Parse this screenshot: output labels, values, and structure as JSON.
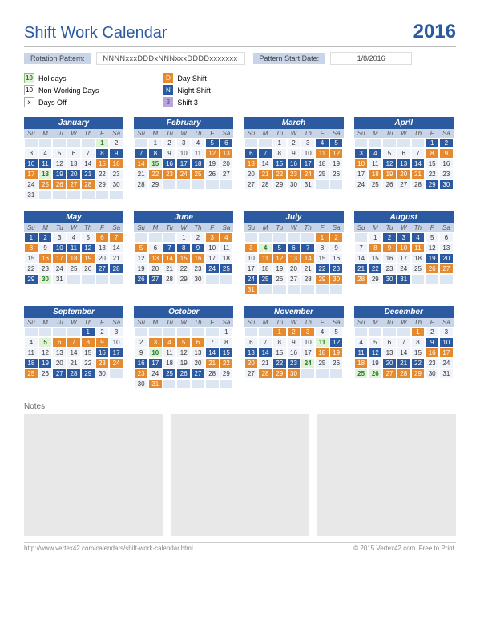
{
  "title": "Shift Work Calendar",
  "year": "2016",
  "rotation_label": "Rotation Pattern:",
  "rotation_value": "NNNNxxxDDDxNNNxxxDDDDxxxxxxx",
  "startdate_label": "Pattern Start Date:",
  "startdate_value": "1/8/2016",
  "legend": {
    "holidays": "Holidays",
    "holidays_sw": "10",
    "nonworking": "Non-Working Days",
    "nonworking_sw": "10",
    "daysoff": "Days Off",
    "daysoff_sw": "x",
    "dayshift": "Day Shift",
    "dayshift_sw": "D",
    "nightshift": "Night Shift",
    "nightshift_sw": "N",
    "shift3": "Shift 3",
    "shift3_sw": "3"
  },
  "dayheads": [
    "Su",
    "M",
    "Tu",
    "W",
    "Th",
    "F",
    "Sa"
  ],
  "notes_title": "Notes",
  "footer_left": "http://www.vertex42.com/calendars/shift-work-calendar.html",
  "footer_right": "© 2015 Vertex42.com. Free to Print.",
  "months": [
    {
      "name": "January",
      "start": 5,
      "len": 31,
      "hol": [
        1,
        18
      ],
      "pat": {
        "8": "N",
        "9": "N",
        "10": "N",
        "11": "N",
        "15": "D",
        "16": "D",
        "17": "D",
        "19": "N",
        "20": "N",
        "21": "N",
        "25": "D",
        "26": "D",
        "27": "D",
        "28": "D"
      }
    },
    {
      "name": "February",
      "start": 1,
      "len": 29,
      "hol": [
        15
      ],
      "pat": {
        "5": "N",
        "6": "N",
        "7": "N",
        "8": "N",
        "12": "D",
        "13": "D",
        "14": "D",
        "16": "N",
        "17": "N",
        "18": "N",
        "22": "D",
        "23": "D",
        "24": "D",
        "25": "D"
      }
    },
    {
      "name": "March",
      "start": 2,
      "len": 31,
      "hol": [],
      "pat": {
        "4": "N",
        "5": "N",
        "6": "N",
        "7": "N",
        "11": "D",
        "12": "D",
        "13": "D",
        "15": "N",
        "16": "N",
        "17": "N",
        "21": "D",
        "22": "D",
        "23": "D",
        "24": "D"
      }
    },
    {
      "name": "April",
      "start": 5,
      "len": 30,
      "hol": [],
      "pat": {
        "1": "N",
        "2": "N",
        "3": "N",
        "4": "N",
        "8": "D",
        "9": "D",
        "10": "D",
        "12": "N",
        "13": "N",
        "14": "N",
        "18": "D",
        "19": "D",
        "20": "D",
        "21": "D",
        "29": "N",
        "30": "N"
      }
    },
    {
      "name": "May",
      "start": 0,
      "len": 31,
      "hol": [
        30
      ],
      "pat": {
        "1": "N",
        "2": "N",
        "6": "D",
        "7": "D",
        "8": "D",
        "10": "N",
        "11": "N",
        "12": "N",
        "16": "D",
        "17": "D",
        "18": "D",
        "19": "D",
        "27": "N",
        "28": "N",
        "29": "N"
      }
    },
    {
      "name": "June",
      "start": 3,
      "len": 30,
      "hol": [],
      "pat": {
        "3": "D",
        "4": "D",
        "5": "D",
        "7": "N",
        "8": "N",
        "9": "N",
        "13": "D",
        "14": "D",
        "15": "D",
        "16": "D",
        "24": "N",
        "25": "N",
        "26": "N",
        "27": "N"
      }
    },
    {
      "name": "July",
      "start": 5,
      "len": 31,
      "hol": [
        4
      ],
      "pat": {
        "1": "D",
        "2": "D",
        "3": "D",
        "5": "N",
        "6": "N",
        "7": "N",
        "11": "D",
        "12": "D",
        "13": "D",
        "14": "D",
        "22": "N",
        "23": "N",
        "24": "N",
        "25": "N",
        "29": "D",
        "30": "D",
        "31": "D"
      }
    },
    {
      "name": "August",
      "start": 1,
      "len": 31,
      "hol": [],
      "pat": {
        "2": "N",
        "3": "N",
        "4": "N",
        "8": "D",
        "9": "D",
        "10": "D",
        "11": "D",
        "19": "N",
        "20": "N",
        "21": "N",
        "22": "N",
        "26": "D",
        "27": "D",
        "28": "D",
        "30": "N",
        "31": "N"
      }
    },
    {
      "name": "September",
      "start": 4,
      "len": 30,
      "hol": [
        5
      ],
      "pat": {
        "1": "N",
        "6": "D",
        "7": "D",
        "8": "D",
        "9": "D",
        "16": "N",
        "17": "N",
        "18": "N",
        "19": "N",
        "23": "D",
        "24": "D",
        "25": "D",
        "27": "N",
        "28": "N",
        "29": "N"
      }
    },
    {
      "name": "October",
      "start": 6,
      "len": 31,
      "hol": [
        10
      ],
      "pat": {
        "3": "D",
        "4": "D",
        "5": "D",
        "6": "D",
        "14": "N",
        "15": "N",
        "16": "N",
        "17": "N",
        "21": "D",
        "22": "D",
        "23": "D",
        "25": "N",
        "26": "N",
        "27": "N",
        "31": "D"
      }
    },
    {
      "name": "November",
      "start": 2,
      "len": 30,
      "hol": [
        11,
        24
      ],
      "pat": {
        "1": "D",
        "2": "D",
        "3": "D",
        "12": "N",
        "13": "N",
        "14": "N",
        "18": "D",
        "19": "D",
        "20": "D",
        "22": "N",
        "23": "N",
        "28": "D",
        "29": "D",
        "30": "D"
      }
    },
    {
      "name": "December",
      "start": 4,
      "len": 31,
      "hol": [
        25,
        26
      ],
      "pat": {
        "1": "D",
        "9": "N",
        "10": "N",
        "11": "N",
        "12": "N",
        "16": "D",
        "17": "D",
        "18": "D",
        "20": "N",
        "21": "N",
        "22": "N",
        "27": "D",
        "28": "D",
        "29": "D"
      }
    }
  ]
}
